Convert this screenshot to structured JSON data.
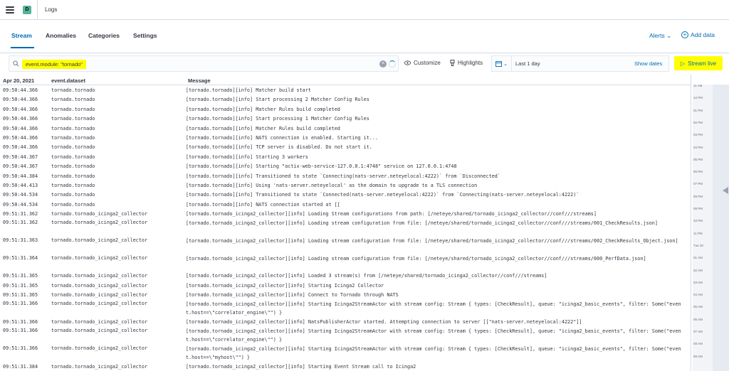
{
  "header": {
    "space_initial": "D",
    "app_title": "Logs"
  },
  "tabs": [
    {
      "label": "Stream"
    },
    {
      "label": "Anomalies"
    },
    {
      "label": "Categories"
    },
    {
      "label": "Settings"
    }
  ],
  "header_actions": {
    "alerts": "Alerts",
    "add_data": "Add data"
  },
  "toolbar": {
    "query": "event.module: \"tornado\"",
    "customize": "Customize",
    "highlights": "Highlights",
    "time_range": "Last 1 day",
    "show_dates": "Show dates",
    "stream_live": "Stream live"
  },
  "columns": {
    "date": "Apr 20, 2021",
    "dataset": "event.dataset",
    "message": "Message"
  },
  "rows": [
    {
      "time": "09:50:44.366",
      "dataset": "tornado.tornado",
      "message": "[tornado.tornado][info] Matcher build start"
    },
    {
      "time": "09:50:44.366",
      "dataset": "tornado.tornado",
      "message": "[tornado.tornado][info] Start processing 2 Matcher Config Rules"
    },
    {
      "time": "09:50:44.366",
      "dataset": "tornado.tornado",
      "message": "[tornado.tornado][info] Matcher Rules build completed"
    },
    {
      "time": "09:50:44.366",
      "dataset": "tornado.tornado",
      "message": "[tornado.tornado][info] Start processing 1 Matcher Config Rules"
    },
    {
      "time": "09:50:44.366",
      "dataset": "tornado.tornado",
      "message": "[tornado.tornado][info] Matcher Rules build completed"
    },
    {
      "time": "09:50:44.366",
      "dataset": "tornado.tornado",
      "message": "[tornado.tornado][info] NATS connection is enabled. Starting it..."
    },
    {
      "time": "09:50:44.366",
      "dataset": "tornado.tornado",
      "message": "[tornado.tornado][info] TCP server is disabled. Do not start it."
    },
    {
      "time": "09:50:44.367",
      "dataset": "tornado.tornado",
      "message": "[tornado.tornado][info] Starting 3 workers"
    },
    {
      "time": "09:50:44.367",
      "dataset": "tornado.tornado",
      "message": "[tornado.tornado][info] Starting \"actix-web-service-127.0.0.1:4748\" service on 127.0.0.1:4748"
    },
    {
      "time": "09:50:44.384",
      "dataset": "tornado.tornado",
      "message": "[tornado.tornado][info] Transitioned to state `Connecting(nats-server.neteyelocal:4222)` from `Disconnected`"
    },
    {
      "time": "09:50:44.413",
      "dataset": "tornado.tornado",
      "message": "[tornado.tornado][info] Using 'nats-server.neteyelocal' as the domain to upgrade to a TLS connection"
    },
    {
      "time": "09:50:44.534",
      "dataset": "tornado.tornado",
      "message": "[tornado.tornado][info] Transitioned to state `Connected(nats-server.neteyelocal:4222)` from `Connecting(nats-server.neteyelocal:4222)`"
    },
    {
      "time": "09:50:44.534",
      "dataset": "tornado.tornado",
      "message": "[tornado.tornado][info] NATS connection started at [["
    },
    {
      "time": "09:51:31.362",
      "dataset": "tornado.tornado_icinga2_collector",
      "message": "[tornado.tornado_icinga2_collector][info] Loading Stream configurations from path: [/neteye/shared/tornado_icinga2_collector//conf///streams]"
    },
    {
      "time": "09:51:31.362",
      "dataset": "tornado.tornado_icinga2_collector",
      "message": "[tornado.tornado_icinga2_collector][info] Loading stream configuration from file: [/neteye/shared/tornado_icinga2_collector//conf///streams/001_CheckResults.json]"
    },
    {
      "time": "09:51:31.363",
      "dataset": "tornado.tornado_icinga2_collector",
      "message": "[tornado.tornado_icinga2_collector][info] Loading stream configuration from file: [/neteye/shared/tornado_icinga2_collector//conf///streams/002_CheckResults_Object.json]"
    },
    {
      "time": "09:51:31.364",
      "dataset": "tornado.tornado_icinga2_collector",
      "message": "[tornado.tornado_icinga2_collector][info] Loading stream configuration from file: [/neteye/shared/tornado_icinga2_collector//conf///streams/000_PerfData.json]"
    },
    {
      "time": "09:51:31.365",
      "dataset": "tornado.tornado_icinga2_collector",
      "message": "[tornado.tornado_icinga2_collector][info] Loaded 3 stream(s) from [/neteye/shared/tornado_icinga2_collector//conf///streams]"
    },
    {
      "time": "09:51:31.365",
      "dataset": "tornado.tornado_icinga2_collector",
      "message": "[tornado.tornado_icinga2_collector][info] Starting Icinga2 Collector"
    },
    {
      "time": "09:51:31.365",
      "dataset": "tornado.tornado_icinga2_collector",
      "message": "[tornado.tornado_icinga2_collector][info] Connect to Tornado through NATS"
    },
    {
      "time": "09:51:31.366",
      "dataset": "tornado.tornado_icinga2_collector",
      "message": "[tornado.tornado_icinga2_collector][info] Starting Icinga2StreamActor with stream config: Stream { types: [CheckResult], queue: \"icinga2_basic_events\", filter: Some(\"event.host==\\\"correlator_engine\\\"\") }"
    },
    {
      "time": "09:51:31.366",
      "dataset": "tornado.tornado_icinga2_collector",
      "message": "[tornado.tornado_icinga2_collector][info] NatsPublisherActor started. Attempting connection to server [[\"nats-server.neteyelocal:4222\"]]"
    },
    {
      "time": "09:51:31.366",
      "dataset": "tornado.tornado_icinga2_collector",
      "message": "[tornado.tornado_icinga2_collector][info] Starting Icinga2StreamActor with stream config: Stream { types: [CheckResult], queue: \"icinga2_basic_events\", filter: Some(\"event.host==\\\"correlator_engine\\\"\") }"
    },
    {
      "time": "09:51:31.366",
      "dataset": "tornado.tornado_icinga2_collector",
      "message": "[tornado.tornado_icinga2_collector][info] Starting Icinga2StreamActor with stream config: Stream { types: [CheckResult], queue: \"icinga2_basic_events\", filter: Some(\"event.host==\\\"myhost\\\"\") }"
    },
    {
      "time": "09:51:31.384",
      "dataset": "tornado.tornado_icinga2_collector",
      "message": "[tornado.tornado_icinga2_collector][info] Starting Event Stream call to Icinga2"
    }
  ],
  "minimap": {
    "ticks": [
      "11 AM",
      "12 PM",
      "01 PM",
      "02 PM",
      "03 PM",
      "04 PM",
      "05 PM",
      "06 PM",
      "07 PM",
      "08 PM",
      "09 PM",
      "10 PM",
      "11 PM",
      "Tue 20",
      "01 AM",
      "02 AM",
      "03 AM",
      "04 AM",
      "05 AM",
      "06 AM",
      "07 AM",
      "08 AM",
      "09 AM"
    ]
  }
}
